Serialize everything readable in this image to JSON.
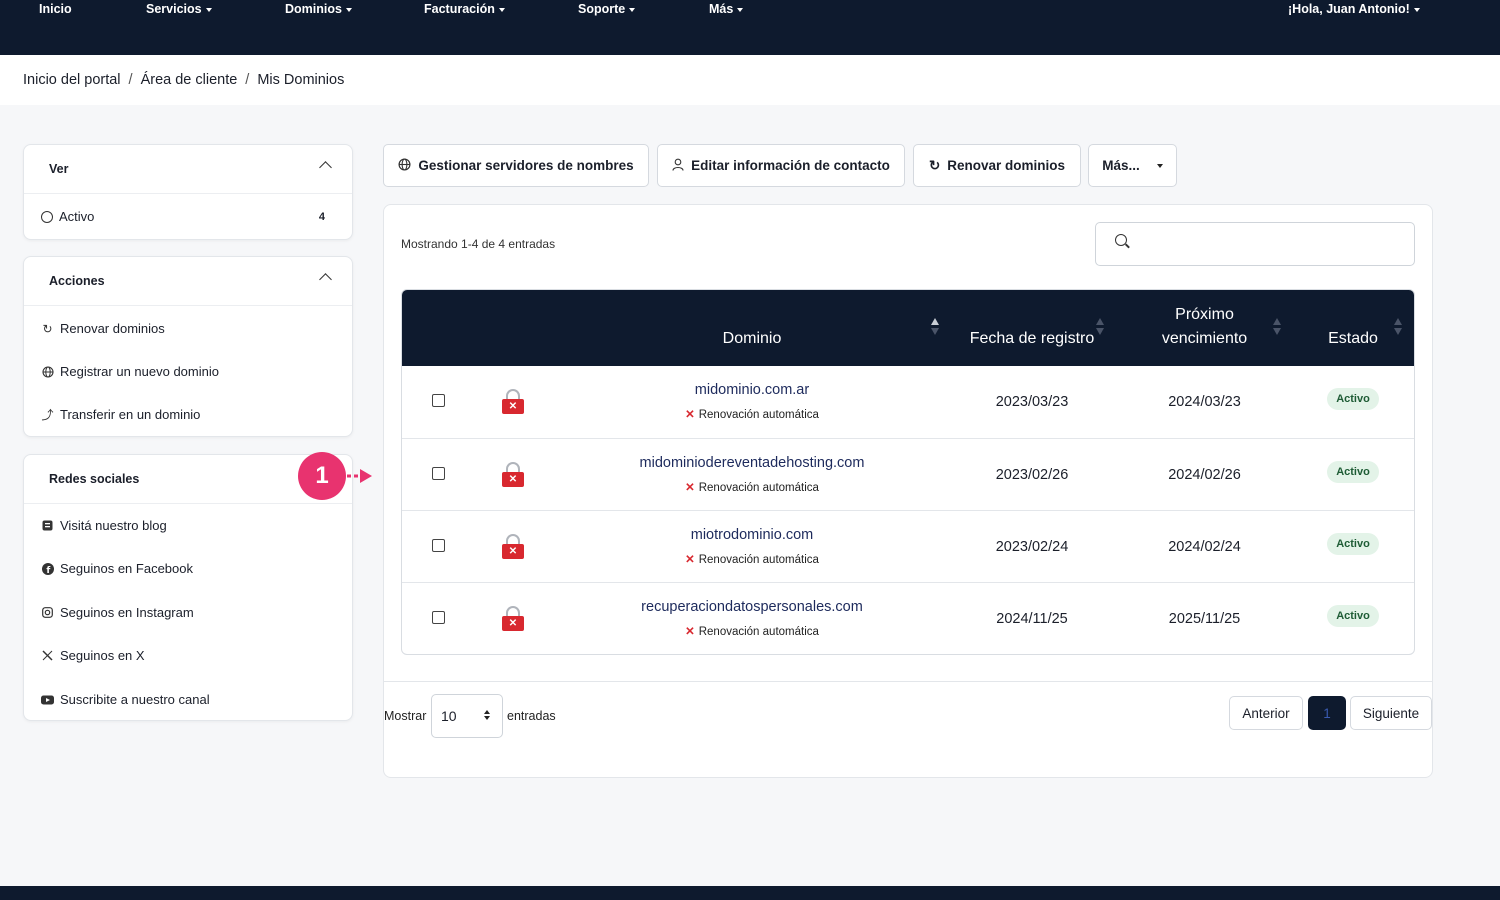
{
  "nav": {
    "items": [
      "Inicio",
      "Servicios",
      "Dominios",
      "Facturación",
      "Soporte",
      "Más"
    ],
    "greeting": "¡Hola, Juan Antonio!"
  },
  "breadcrumb": [
    "Inicio del portal",
    "Área de cliente",
    "Mis Dominios"
  ],
  "sidebar": {
    "ver": {
      "title": "Ver",
      "item_label": "Activo",
      "item_count": "4"
    },
    "acciones": {
      "title": "Acciones",
      "items": [
        "Renovar dominios",
        "Registrar un nuevo dominio",
        "Transferir en un dominio"
      ]
    },
    "redes": {
      "title": "Redes sociales",
      "items": [
        "Visitá nuestro blog",
        "Seguinos en Facebook",
        "Seguinos en Instagram",
        "Seguinos en X",
        "Suscribite a nuestro canal"
      ]
    }
  },
  "annotation": {
    "number": "1"
  },
  "toolbar": {
    "nameservers": "Gestionar servidores de nombres",
    "contact": "Editar información de contacto",
    "renew": "Renovar dominios",
    "more": "Más..."
  },
  "table": {
    "showing": "Mostrando 1-4 de 4 entradas",
    "headers": {
      "domain": "Dominio",
      "reg_date": "Fecha de registro",
      "next_due_1": "Próximo",
      "next_due_2": "vencimiento",
      "status": "Estado"
    },
    "rows": [
      {
        "domain": "midominio.com.ar",
        "auto": "Renovación automática",
        "reg": "2023/03/23",
        "due": "2024/03/23",
        "status": "Activo"
      },
      {
        "domain": "midominiodereventadehosting.com",
        "auto": "Renovación automática",
        "reg": "2023/02/26",
        "due": "2024/02/26",
        "status": "Activo"
      },
      {
        "domain": "miotrodominio.com",
        "auto": "Renovación automática",
        "reg": "2023/02/24",
        "due": "2024/02/24",
        "status": "Activo"
      },
      {
        "domain": "recuperaciondatospersonales.com",
        "auto": "Renovación automática",
        "reg": "2024/11/25",
        "due": "2025/11/25",
        "status": "Activo"
      }
    ]
  },
  "pagination": {
    "show_label": "Mostrar",
    "page_size": "10",
    "entries_label": "entradas",
    "prev": "Anterior",
    "current": "1",
    "next": "Siguiente"
  }
}
